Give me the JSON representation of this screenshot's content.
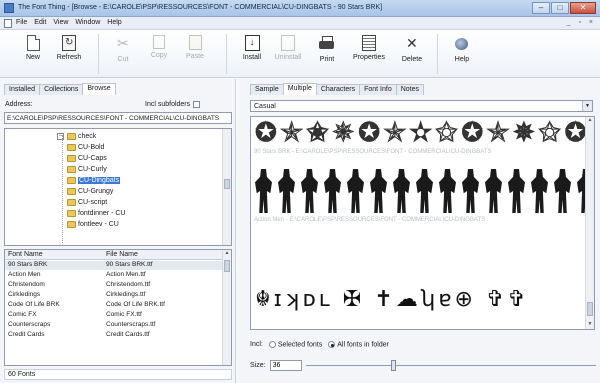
{
  "window": {
    "title": "The Font Thing - [Browse - E:\\CAROLE\\PSP\\RESSOURCES\\FONT - COMMERCIAL\\CU-DINGBATS - 90 Stars BRK]",
    "controls": [
      "–",
      "□",
      "✕"
    ]
  },
  "menu": {
    "items": [
      "File",
      "Edit",
      "View",
      "Window",
      "Help"
    ],
    "right": "_ ▫ ×"
  },
  "toolbar": {
    "buttons": [
      {
        "label": "New",
        "icon": "new-icon",
        "enabled": true
      },
      {
        "label": "Refresh",
        "icon": "refresh-icon",
        "enabled": true
      },
      {
        "label": "Cut",
        "icon": "cut-icon",
        "enabled": false
      },
      {
        "label": "Copy",
        "icon": "copy-icon",
        "enabled": false
      },
      {
        "label": "Paste",
        "icon": "paste-icon",
        "enabled": false
      },
      {
        "label": "Install",
        "icon": "install-icon",
        "enabled": true
      },
      {
        "label": "Uninstall",
        "icon": "uninstall-icon",
        "enabled": false
      },
      {
        "label": "Print",
        "icon": "print-icon",
        "enabled": true
      },
      {
        "label": "Properties",
        "icon": "properties-icon",
        "enabled": true
      },
      {
        "label": "Delete",
        "icon": "delete-icon",
        "enabled": true
      },
      {
        "label": "Help",
        "icon": "help-icon",
        "enabled": true
      }
    ]
  },
  "left": {
    "tabs": [
      "Installed",
      "Collections",
      "Browse"
    ],
    "active_tab": "Browse",
    "address_label": "Address:",
    "include_subfolders_label": "Incl subfolders",
    "address_value": "E:\\CAROLE\\PSP\\RESSOURCES\\FONT - COMMERCIAL\\CU-DINGBATS",
    "tree": [
      {
        "name": "check",
        "selected": false
      },
      {
        "name": "CU-Bold",
        "selected": false
      },
      {
        "name": "CU-Caps",
        "selected": false
      },
      {
        "name": "CU-Curly",
        "selected": false
      },
      {
        "name": "CU-Dingbats",
        "selected": true
      },
      {
        "name": "CU-Grungy",
        "selected": false
      },
      {
        "name": "CU-script",
        "selected": false
      },
      {
        "name": "fontdinner - CU",
        "selected": false
      },
      {
        "name": "fontleev - CU",
        "selected": false
      }
    ],
    "list_headers": {
      "font_name": "Font Name",
      "file_name": "File Name"
    },
    "fonts": [
      {
        "font": "90 Stars BRK",
        "file": "90 Stars BRK.ttf",
        "selected": true
      },
      {
        "font": "Action Men",
        "file": "Action Men.ttf",
        "selected": false
      },
      {
        "font": "Christendom",
        "file": "Christendom.ttf",
        "selected": false
      },
      {
        "font": "Cirkledings",
        "file": "Cirkledings.ttf",
        "selected": false
      },
      {
        "font": "Code Of Life BRK",
        "file": "Code Of Life BRK.ttf",
        "selected": false
      },
      {
        "font": "Comic FX",
        "file": "Comic FX.ttf",
        "selected": false
      },
      {
        "font": "Counterscraps",
        "file": "Counterscraps.ttf",
        "selected": false
      },
      {
        "font": "Credit Cards",
        "file": "Credit Cards.ttf",
        "selected": false
      }
    ],
    "status": "60 Fonts"
  },
  "right": {
    "tabs": [
      "Sample",
      "Multiple",
      "Characters",
      "Font Info",
      "Notes"
    ],
    "active_tab": "Multiple",
    "sample_text": "Casual",
    "preview_captions": [
      "90 Stars BRK - E:\\CAROLE\\PSP\\RESSOURCES\\FONT - COMMERCIAL\\CU-DINGBATS",
      "Action Men - E:\\CAROLE\\PSP\\RESSOURCES\\FONT - COMMERCIAL\\CU-DINGBATS"
    ],
    "stars_glyphs": [
      "✪",
      "✯",
      "✬",
      "✵",
      "✪",
      "✯",
      "✫",
      "✬",
      "✪",
      "✯",
      "✵",
      "✬",
      "✪"
    ],
    "dingbat_glyphs": "☬ɪʞᴅʟ ✠ ✝☁ʮɐ⊕ ✞✞",
    "incl_label": "Incl:",
    "radio_selected_fonts": "Selected fonts",
    "radio_all_fonts": "All fonts in folder",
    "size_label": "Size:",
    "size_value": "36",
    "size_slider_fraction": 0.3
  }
}
